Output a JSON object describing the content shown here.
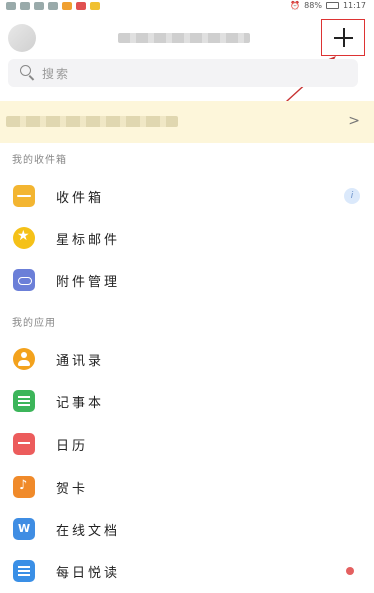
{
  "status_bar": {
    "battery": "88%",
    "time": "11:17"
  },
  "header": {
    "add_symbol": "+"
  },
  "search": {
    "placeholder": "搜索"
  },
  "banner": {
    "chevron": ">"
  },
  "sections": {
    "mailboxes_title": "我的收件箱",
    "apps_title": "我的应用"
  },
  "mailboxes": [
    {
      "label": "收件箱",
      "icon": "inbox-icon"
    },
    {
      "label": "星标邮件",
      "icon": "star-icon"
    },
    {
      "label": "附件管理",
      "icon": "attachment-icon"
    }
  ],
  "apps": [
    {
      "label": "通讯录",
      "icon": "contacts-icon"
    },
    {
      "label": "记事本",
      "icon": "notes-icon"
    },
    {
      "label": "日历",
      "icon": "calendar-icon"
    },
    {
      "label": "贺卡",
      "icon": "greeting-card-icon"
    },
    {
      "label": "在线文档",
      "icon": "document-icon"
    },
    {
      "label": "每日悦读",
      "icon": "daily-reading-icon"
    }
  ],
  "inbox_badge": "i",
  "colors": {
    "accent_red": "#dd3333",
    "banner_bg": "#fdf6da"
  }
}
